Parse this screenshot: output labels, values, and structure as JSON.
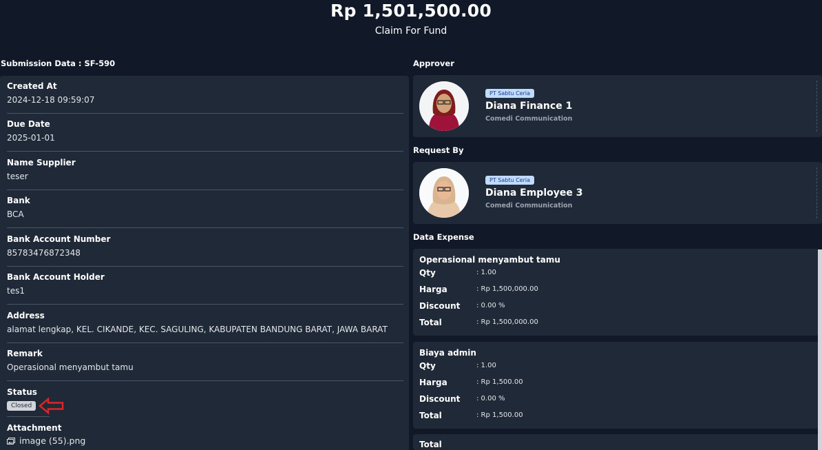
{
  "header": {
    "amount": "Rp 1,501,500.00",
    "subtitle": "Claim For Fund"
  },
  "submission": {
    "title": "Submission Data : SF-590",
    "fields": [
      {
        "label": "Created At",
        "value": "2024-12-18 09:59:07"
      },
      {
        "label": "Due Date",
        "value": "2025-01-01"
      },
      {
        "label": "Name Supplier",
        "value": "teser"
      },
      {
        "label": "Bank",
        "value": "BCA"
      },
      {
        "label": "Bank Account Number",
        "value": "85783476872348"
      },
      {
        "label": "Bank Account Holder",
        "value": "tes1"
      },
      {
        "label": "Address",
        "value": "alamat lengkap, KEL. CIKANDE, KEC. SAGULING, KABUPATEN BANDUNG BARAT, JAWA BARAT"
      },
      {
        "label": "Remark",
        "value": "Operasional menyambut tamu"
      }
    ],
    "status": {
      "label": "Status",
      "value": "Closed"
    },
    "attachment": {
      "label": "Attachment",
      "value": "image (55).png",
      "icon": "image-icon"
    }
  },
  "approver": {
    "title": "Approver",
    "company": "PT Sabtu Ceria",
    "name": "Diana Finance 1",
    "org": "Comedi Communication"
  },
  "requester": {
    "title": "Request By",
    "company": "PT Sabtu Ceria",
    "name": "Diana Employee 3",
    "org": "Comedi Communication"
  },
  "expense": {
    "title": "Data Expense",
    "items": [
      {
        "name": "Operasional menyambut tamu",
        "qty": ": 1.00",
        "harga": ": Rp 1,500,000.00",
        "discount": ": 0.00 %",
        "total": ": Rp 1,500,000.00"
      },
      {
        "name": "Biaya admin",
        "qty": ": 1.00",
        "harga": ": Rp 1,500.00",
        "discount": ": 0.00 %",
        "total": ": Rp 1,500.00"
      }
    ],
    "row_labels": {
      "qty": "Qty",
      "harga": "Harga",
      "discount": "Discount",
      "total": "Total"
    },
    "summary_label": "Total"
  },
  "colors": {
    "background": "#111827",
    "card": "#1f2937",
    "badge": "#bfdbfe",
    "arrow": "#dc2626"
  }
}
